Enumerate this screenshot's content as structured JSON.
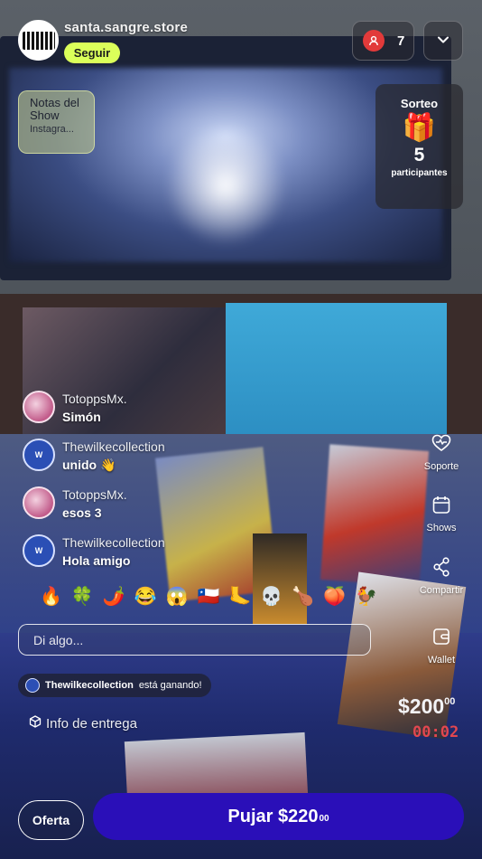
{
  "header": {
    "store_name": "santa.sangre.store",
    "follow_label": "Seguir",
    "viewers_count": "7"
  },
  "notes": {
    "title": "Notas del Show",
    "subtitle": "Instagra..."
  },
  "giveaway": {
    "title": "Sorteo",
    "count": "5",
    "label": "participantes"
  },
  "chat": {
    "messages": [
      {
        "user": "TotoppsMx.",
        "text": "Simón"
      },
      {
        "user": "Thewilkecollection",
        "text": "unido 👋"
      },
      {
        "user": "TotoppsMx.",
        "text": "esos 3"
      },
      {
        "user": "Thewilkecollection",
        "text": "Hola amigo"
      }
    ],
    "reactions": [
      "🔥",
      "🍀",
      "🌶️",
      "😂",
      "😱",
      "🇨🇱",
      "🦶",
      "💀",
      "🍗",
      "🍑",
      "🐓"
    ],
    "input_placeholder": "Di algo..."
  },
  "auction": {
    "winner_user": "Thewilkecollection",
    "winner_text": "está ganando!",
    "price_main": "$200",
    "price_cents": "00",
    "timer": "00:02"
  },
  "delivery_label": "Info de entrega",
  "rail": {
    "support": "Soporte",
    "shows": "Shows",
    "share": "Compartir",
    "wallet": "Wallet"
  },
  "actions": {
    "offer": "Oferta",
    "bid_main": "Pujar $220",
    "bid_cents": "00"
  },
  "colors": {
    "follow": "#dbff5a",
    "bid_button": "#2a0fb8",
    "timer": "#e2474f",
    "viewer_badge": "#e23a3a"
  }
}
